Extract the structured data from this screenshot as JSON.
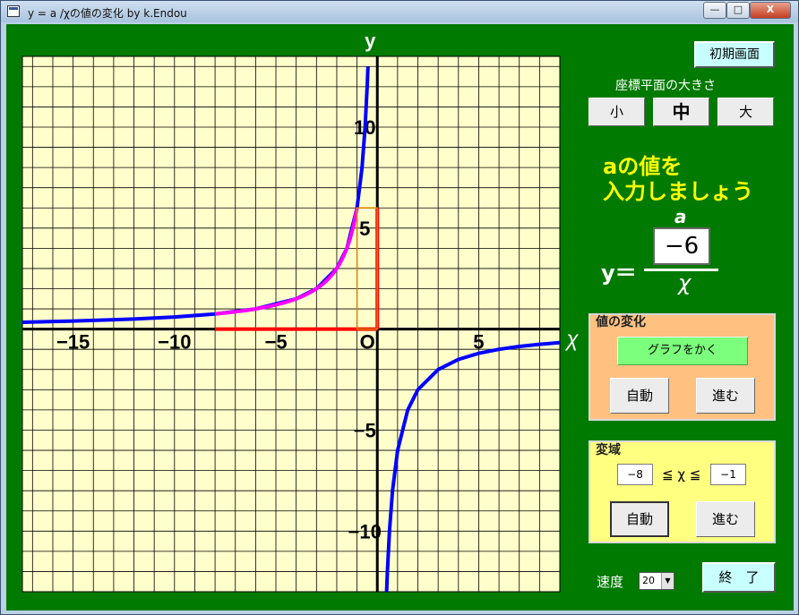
{
  "window": {
    "title": "y = a /χの値の変化 by k.Endou"
  },
  "titlebar_buttons": {
    "minimize": "—",
    "maximize": "□",
    "close": "X"
  },
  "colors": {
    "background": "#007a00",
    "grid_bg": "#ffffcc",
    "curve": "#0000ff",
    "highlight": "#ff00ff",
    "range_line": "#ff0000",
    "accent_text": "#ffff00"
  },
  "chart_data": {
    "type": "line",
    "xlabel": "χ",
    "ylabel": "y",
    "xlim": [
      -17.5,
      9
    ],
    "ylim": [
      -13,
      13.5
    ],
    "x_ticks": [
      -15,
      -10,
      -5,
      5
    ],
    "y_ticks": [
      10,
      5,
      -5,
      -10
    ],
    "origin_label": "O",
    "function": "y = a/x",
    "a": -6,
    "highlight_domain": [
      -8,
      -1
    ],
    "series": [
      {
        "x": [
          -17.5,
          -15,
          -12,
          -10,
          -8,
          -6,
          -4,
          -3,
          -2,
          -1.5,
          -1,
          -0.75,
          -0.6,
          -0.5,
          -0.46
        ],
        "y": [
          0.34,
          0.4,
          0.5,
          0.6,
          0.75,
          1,
          1.5,
          2,
          3,
          4,
          6,
          8,
          10,
          12,
          13
        ]
      },
      {
        "x": [
          0.46,
          0.5,
          0.6,
          0.75,
          1,
          1.5,
          2,
          3,
          4,
          5,
          6,
          7,
          8,
          9
        ],
        "y": [
          -13,
          -12,
          -10,
          -8,
          -6,
          -4,
          -3,
          -2,
          -1.5,
          -1.2,
          -1,
          -0.86,
          -0.75,
          -0.67
        ]
      }
    ]
  },
  "top_controls": {
    "reset_button": "初期画面",
    "size_label": "座標平面の大きさ",
    "size_small": "小",
    "size_medium": "中",
    "size_large": "大"
  },
  "prompt": {
    "line1": "aの値を",
    "line2": "入力しましょう"
  },
  "formula": {
    "numerator_label": "a",
    "a_value": "−6",
    "lhs": "y＝",
    "denominator": "χ"
  },
  "change_panel": {
    "title": "値の変化",
    "draw_button": "グラフをかく",
    "auto_button": "自動",
    "step_button": "進む"
  },
  "domain_panel": {
    "title": "変域",
    "min_value": "−8",
    "relation": "≦ χ ≦",
    "max_value": "−1",
    "auto_button": "自動",
    "step_button": "進む"
  },
  "bottom": {
    "speed_label": "速度",
    "speed_value": "20",
    "end_button": "終　了"
  }
}
